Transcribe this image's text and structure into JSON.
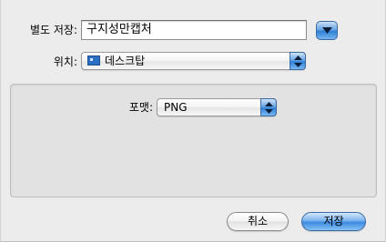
{
  "dialog": {
    "save_as_label": "별도 저장:",
    "filename_value": "구지성만캡처",
    "where_label": "위치:",
    "where_value": "데스크탑",
    "format_label": "포맷:",
    "format_value": "PNG",
    "cancel_label": "취소",
    "save_label": "저장"
  },
  "icons": {
    "disclosure": "chevron-down-icon",
    "popup_arrows": "up-down-arrows-icon",
    "desktop": "desktop-folder-icon"
  },
  "colors": {
    "accent_blue": "#3b8ae0",
    "background": "#ececec"
  }
}
